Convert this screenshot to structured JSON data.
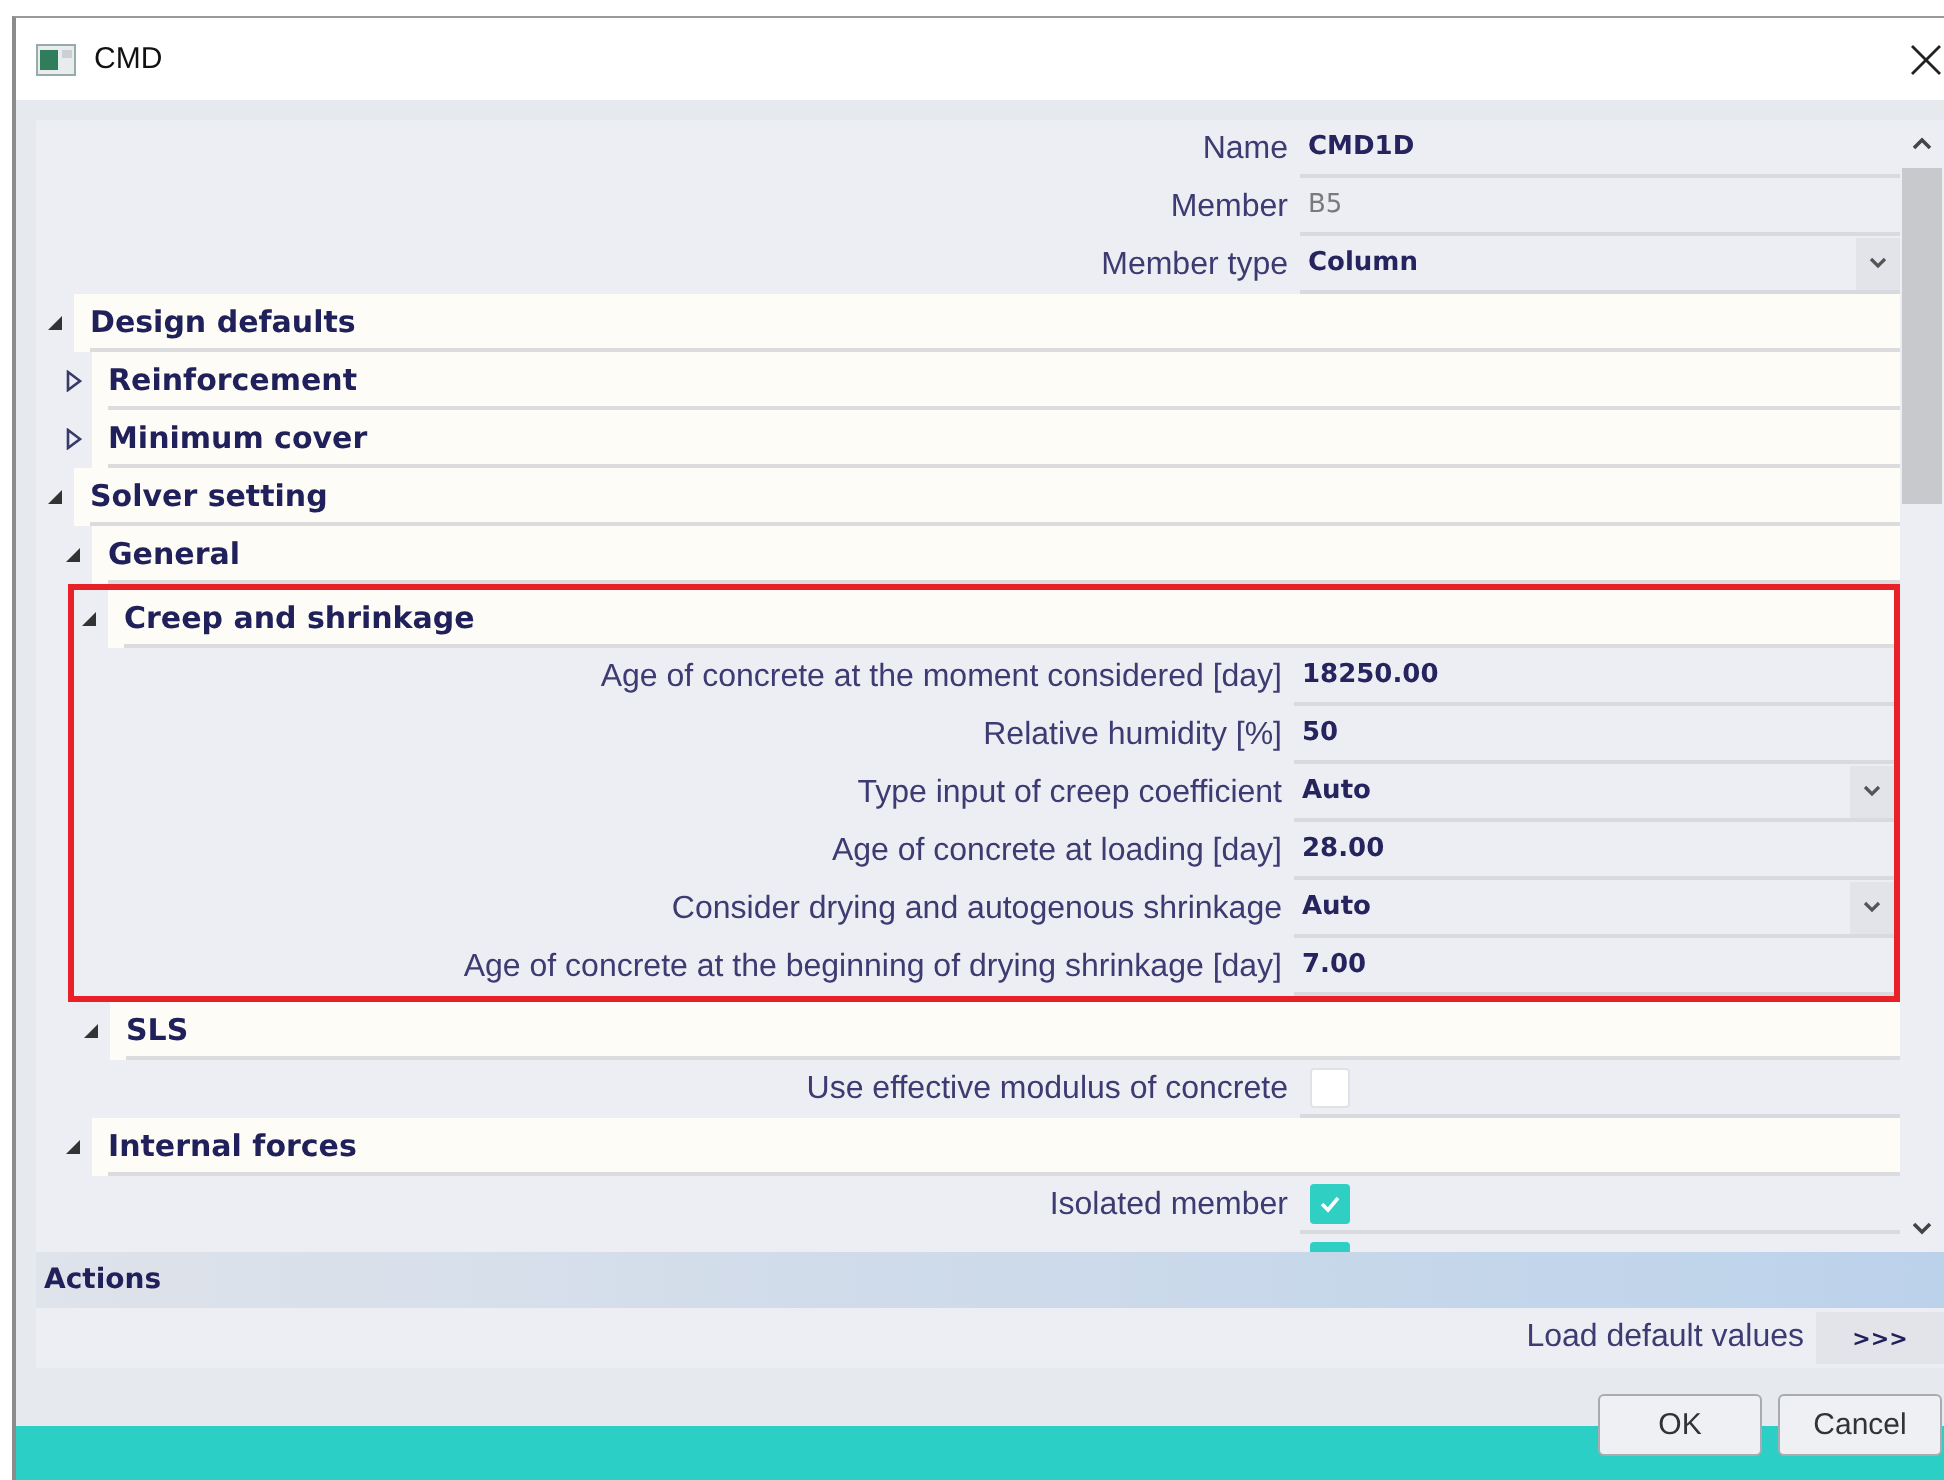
{
  "window": {
    "title": "CMD"
  },
  "grid": [
    {
      "kind": "text",
      "label": "Name",
      "value": "CMD1D"
    },
    {
      "kind": "text",
      "label": "Member",
      "value": "B5",
      "disabled": true
    },
    {
      "kind": "combo",
      "label": "Member type",
      "value": "Column"
    },
    {
      "kind": "group",
      "title": "Design defaults",
      "expanded": true,
      "children": [
        {
          "kind": "group",
          "title": "Reinforcement",
          "expanded": false
        },
        {
          "kind": "group",
          "title": "Minimum cover",
          "expanded": false
        }
      ]
    },
    {
      "kind": "group",
      "title": "Solver setting",
      "expanded": true,
      "children": [
        {
          "kind": "group",
          "title": "General",
          "expanded": true,
          "children": [
            {
              "kind": "group",
              "title": "Creep and shrinkage",
              "expanded": true,
              "highlighted": true,
              "children": [
                {
                  "kind": "text",
                  "label": "Age of concrete at the moment considered [day]",
                  "value": "18250.00"
                },
                {
                  "kind": "text",
                  "label": "Relative humidity [%]",
                  "value": "50"
                },
                {
                  "kind": "combo",
                  "label": "Type input of creep coefficient",
                  "value": "Auto"
                },
                {
                  "kind": "text",
                  "label": "Age of concrete at loading [day]",
                  "value": "28.00"
                },
                {
                  "kind": "combo",
                  "label": "Consider drying and autogenous shrinkage",
                  "value": "Auto"
                },
                {
                  "kind": "text",
                  "label": "Age of concrete at the beginning of drying shrinkage [day]",
                  "value": "7.00"
                }
              ]
            },
            {
              "kind": "group",
              "title": "SLS",
              "expanded": true,
              "children": [
                {
                  "kind": "check",
                  "label": "Use effective modulus of concrete",
                  "checked": false
                }
              ]
            }
          ]
        },
        {
          "kind": "group",
          "title": "Internal forces",
          "expanded": true,
          "children": [
            {
              "kind": "check",
              "label": "Isolated member",
              "checked": true
            },
            {
              "kind": "check",
              "checked": true
            }
          ]
        }
      ]
    }
  ],
  "actions": {
    "title": "Actions",
    "items": [
      {
        "label": "Load default values",
        "button": ">>>"
      }
    ]
  },
  "buttons": [
    {
      "label": "OK"
    },
    {
      "label": "Cancel"
    }
  ]
}
